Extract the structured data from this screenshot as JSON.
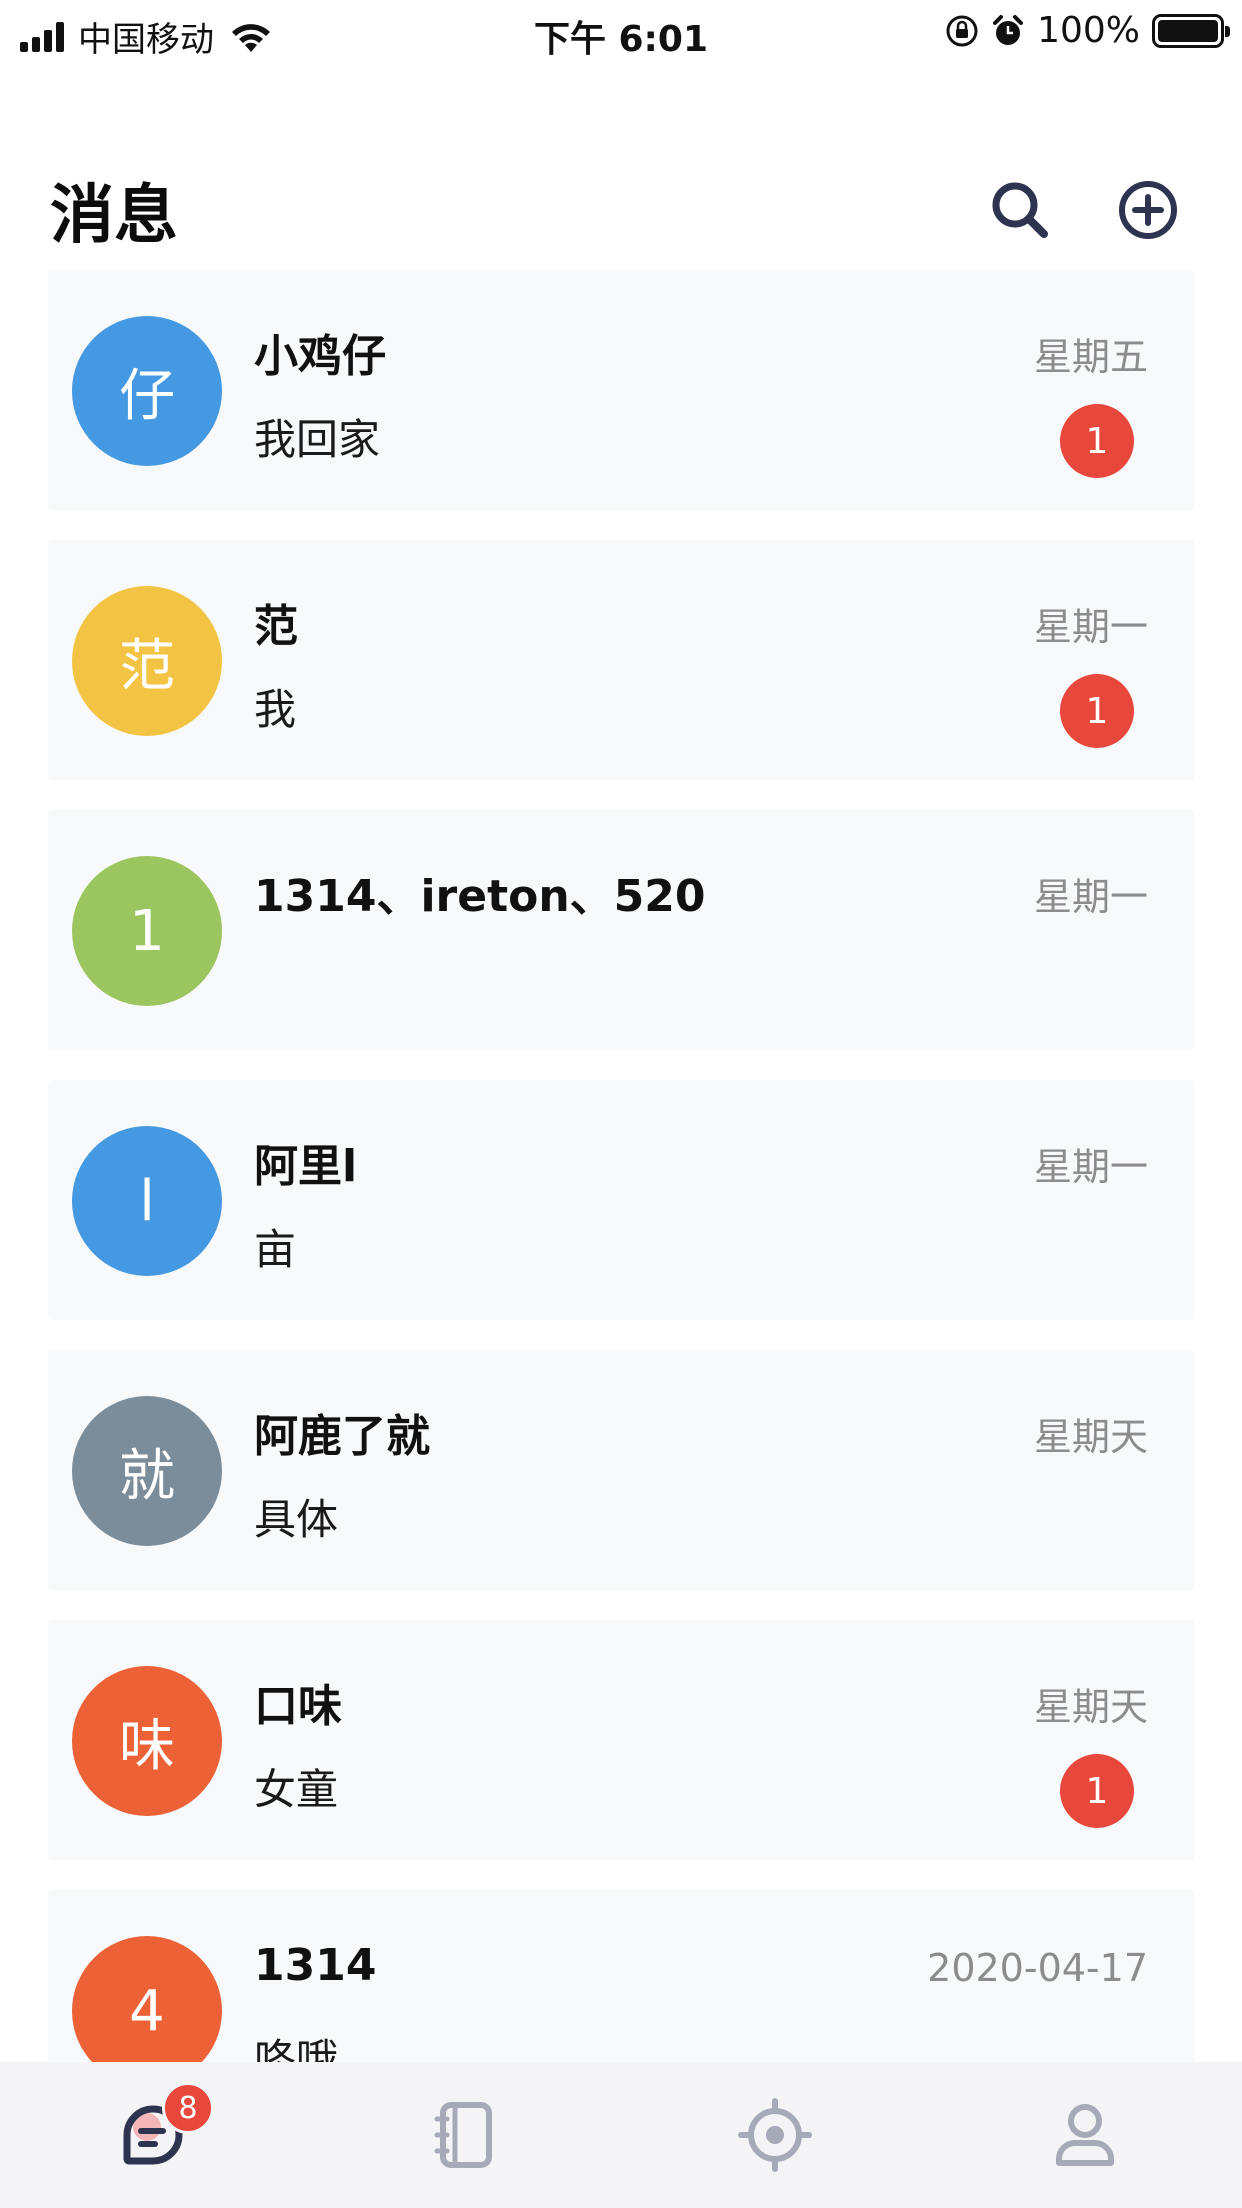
{
  "status_bar": {
    "carrier": "中国移动",
    "time": "下午 6:01",
    "battery": "100%",
    "battery_level": 1.0
  },
  "header": {
    "title": "消息",
    "search_icon": "search-icon",
    "add_icon": "plus-circle-icon"
  },
  "conversations": [
    {
      "avatar": "仔",
      "avatar_color": "#4599e2",
      "name": "小鸡仔",
      "preview": "我回家",
      "time": "星期五",
      "unread": "1"
    },
    {
      "avatar": "范",
      "avatar_color": "#f3c444",
      "name": "范",
      "preview": "我",
      "time": "星期一",
      "unread": "1"
    },
    {
      "avatar": "1",
      "avatar_color": "#9bc55e",
      "name": "1314、ireton、520",
      "preview": "",
      "time": "星期一",
      "unread": ""
    },
    {
      "avatar": "l",
      "avatar_color": "#4599e2",
      "name": "阿里l",
      "preview": "亩",
      "time": "星期一",
      "unread": ""
    },
    {
      "avatar": "就",
      "avatar_color": "#7b8d9a",
      "name": "阿鹿了就",
      "preview": "具体",
      "time": "星期天",
      "unread": ""
    },
    {
      "avatar": "味",
      "avatar_color": "#ec6236",
      "name": "口味",
      "preview": "女童",
      "time": "星期天",
      "unread": "1"
    },
    {
      "avatar": "4",
      "avatar_color": "#ec6236",
      "name": "1314",
      "preview": "咚哦",
      "time": "2020-04-17",
      "unread": ""
    }
  ],
  "tab_bar": {
    "tabs": [
      {
        "name": "messages",
        "icon": "chat-bubble-icon",
        "active": true,
        "badge": "8"
      },
      {
        "name": "contacts",
        "icon": "address-book-icon",
        "active": false,
        "badge": ""
      },
      {
        "name": "discover",
        "icon": "target-icon",
        "active": false,
        "badge": ""
      },
      {
        "name": "profile",
        "icon": "person-icon",
        "active": false,
        "badge": ""
      }
    ],
    "active_color": "#2e3350",
    "inactive_color": "#a6a9b8"
  }
}
